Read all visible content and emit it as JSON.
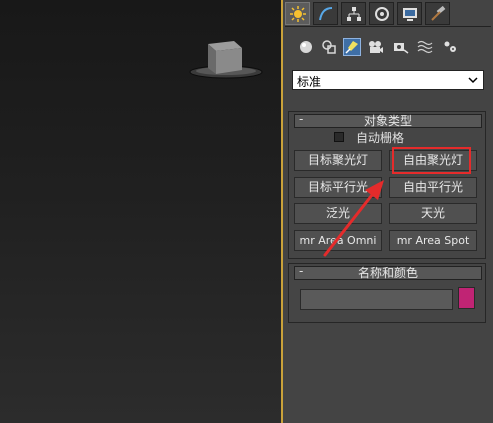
{
  "tabs": [
    {
      "name": "create-tab",
      "icon": "sun-icon",
      "active": true
    },
    {
      "name": "modify-tab",
      "icon": "curve-icon",
      "active": false
    },
    {
      "name": "hierarchy-tab",
      "icon": "hierarchy-icon",
      "active": false
    },
    {
      "name": "motion-tab",
      "icon": "motion-icon",
      "active": false
    },
    {
      "name": "display-tab",
      "icon": "display-icon",
      "active": false
    },
    {
      "name": "utilities-tab",
      "icon": "hammer-icon",
      "active": false
    }
  ],
  "subtools": [
    {
      "name": "geometry",
      "icon": "sphere-icon"
    },
    {
      "name": "shapes",
      "icon": "shapes-icon"
    },
    {
      "name": "lights",
      "icon": "light-icon",
      "active": true
    },
    {
      "name": "cameras",
      "icon": "camera-icon"
    },
    {
      "name": "helpers",
      "icon": "helper-icon"
    },
    {
      "name": "space-warps",
      "icon": "wave-icon"
    },
    {
      "name": "systems",
      "icon": "gear-icon"
    }
  ],
  "dropdown": {
    "value": "标准"
  },
  "object_type": {
    "title": "对象类型",
    "collapse": "-",
    "autogrid_label": "自动栅格",
    "buttons": {
      "target_spot": "目标聚光灯",
      "free_spot": "自由聚光灯",
      "target_direct": "目标平行光",
      "free_direct": "自由平行光",
      "omni": "泛光",
      "skylight": "天光",
      "mr_area_omni": "mr Area Omni",
      "mr_area_spot": "mr Area Spot"
    }
  },
  "name_color": {
    "title": "名称和颜色",
    "collapse": "-",
    "name_value": "",
    "color": "#c02474"
  },
  "colors": {
    "highlight": "#e52b2b",
    "viewport_border": "#caa23a",
    "active_subtool": "#3f6fa6"
  }
}
